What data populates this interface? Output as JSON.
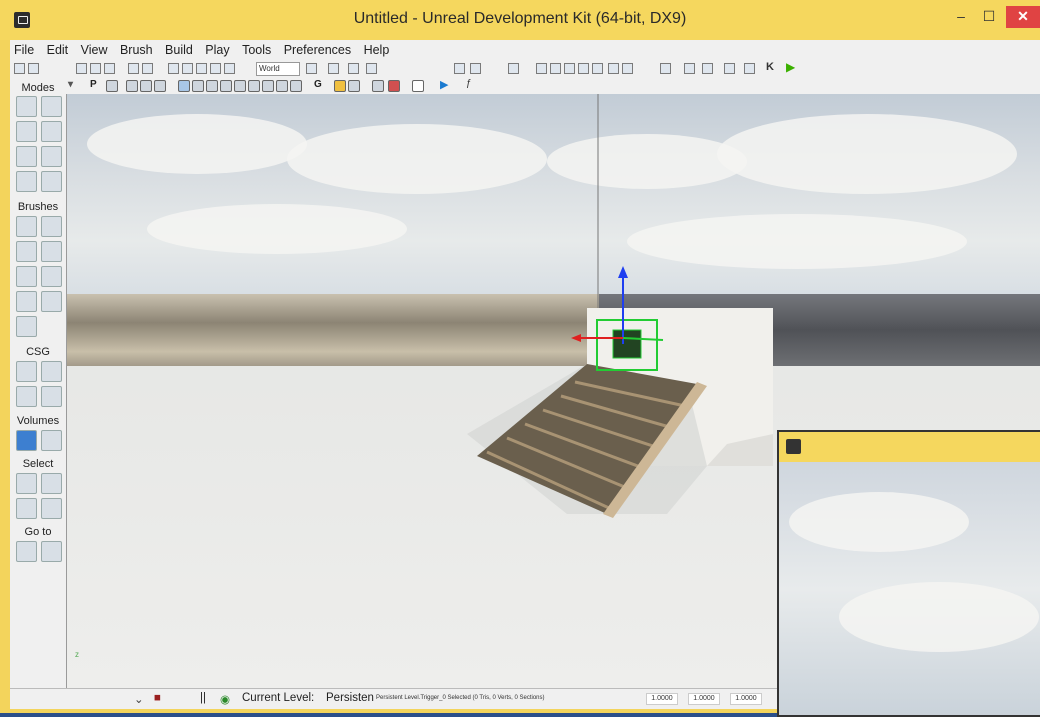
{
  "window": {
    "title": "Untitled - Unreal Development Kit (64-bit, DX9)",
    "min_label": "–",
    "max_label": "☐",
    "close_label": "✕"
  },
  "menu": {
    "items": [
      "File",
      "Edit",
      "View",
      "Brush",
      "Build",
      "Play",
      "Tools",
      "Preferences",
      "Help"
    ]
  },
  "toolbar": {
    "coord_system": "World"
  },
  "toolbar2": {
    "p_label": "P",
    "g_label": "G"
  },
  "sidebar": {
    "modes_label": "Modes",
    "brushes_label": "Brushes",
    "csg_label": "CSG",
    "volumes_label": "Volumes",
    "select_label": "Select",
    "goto_label": "Go to"
  },
  "status": {
    "current_level_label": "Current Level:",
    "current_level_value": "Persisten",
    "selection_info": "Persistent Level.Trigger_0 Selected (0 Tris, 0 Verts, 0 Sections)",
    "scale_x": "1.0000",
    "scale_y": "1.0000",
    "scale_z": "1.0000"
  },
  "viewport": {
    "axis_label": "z"
  },
  "colors": {
    "title_bar": "#f5d75e",
    "close_button": "#e04343",
    "selection_green": "#22cc33",
    "gizmo_blue": "#1f3ff0",
    "gizmo_red": "#e02020"
  }
}
